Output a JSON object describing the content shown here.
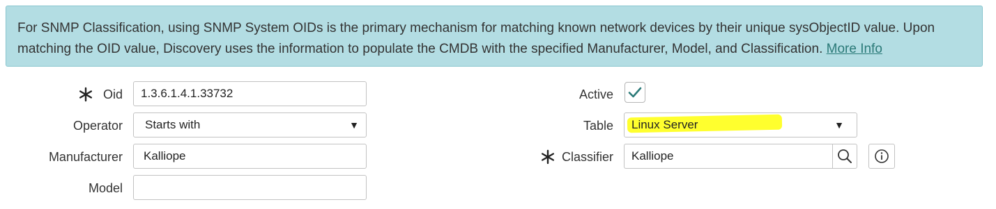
{
  "banner": {
    "text": "For SNMP Classification, using SNMP System OIDs is the primary mechanism for matching known network devices by their unique sysObjectID value. Upon matching the OID value, Discovery uses the information to populate the CMDB with the specified Manufacturer, Model, and Classification.",
    "link_label": "More Info"
  },
  "form": {
    "oid": {
      "label": "Oid",
      "required": true,
      "value": "1.3.6.1.4.1.33732"
    },
    "operator": {
      "label": "Operator",
      "value": "Starts with"
    },
    "manufacturer": {
      "label": "Manufacturer",
      "value": "Kalliope"
    },
    "model": {
      "label": "Model",
      "value": ""
    },
    "active": {
      "label": "Active",
      "checked": true
    },
    "table": {
      "label": "Table",
      "value": "Linux Server"
    },
    "classifier": {
      "label": "Classifier",
      "required": true,
      "value": "Kalliope"
    }
  },
  "icons": {
    "required": "asterisk-icon",
    "select": "caret-down-icon",
    "checkbox": "checkmark-icon",
    "lookup": "search-icon",
    "info": "info-icon"
  },
  "colors": {
    "banner_bg": "#b3dde3",
    "link": "#2b7a78",
    "checkmark": "#2b7a78",
    "highlight": "#ffff2e"
  }
}
